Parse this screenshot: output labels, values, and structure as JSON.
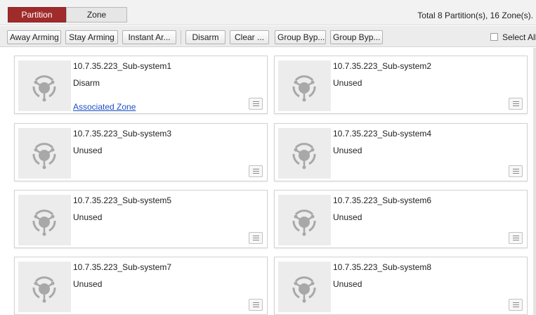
{
  "tabs": [
    {
      "label": "Partition"
    },
    {
      "label": "Zone"
    }
  ],
  "summary": "Total 8 Partition(s), 16 Zone(s).",
  "toolbar": {
    "away_arming": "Away Arming",
    "stay_arming": "Stay Arming",
    "instant_arming": "Instant Ar...",
    "disarm": "Disarm",
    "clear": "Clear ...",
    "group_bypass_1": "Group Byp...",
    "group_bypass_2": "Group Byp...",
    "select_all": "Select All"
  },
  "partitions": [
    {
      "name": "10.7.35.223_Sub-system1",
      "status": "Disarm",
      "link": "Associated Zone"
    },
    {
      "name": "10.7.35.223_Sub-system2",
      "status": "Unused"
    },
    {
      "name": "10.7.35.223_Sub-system3",
      "status": "Unused"
    },
    {
      "name": "10.7.35.223_Sub-system4",
      "status": "Unused"
    },
    {
      "name": "10.7.35.223_Sub-system5",
      "status": "Unused"
    },
    {
      "name": "10.7.35.223_Sub-system6",
      "status": "Unused"
    },
    {
      "name": "10.7.35.223_Sub-system7",
      "status": "Unused"
    },
    {
      "name": "10.7.35.223_Sub-system8",
      "status": "Unused"
    }
  ],
  "icons": {
    "partition": "partition-subsystem-icon",
    "menu": "menu-list-icon"
  },
  "colors": {
    "active_tab": "#a02b2b",
    "link": "#1b4fc7",
    "icon": "#a8a8a8"
  }
}
